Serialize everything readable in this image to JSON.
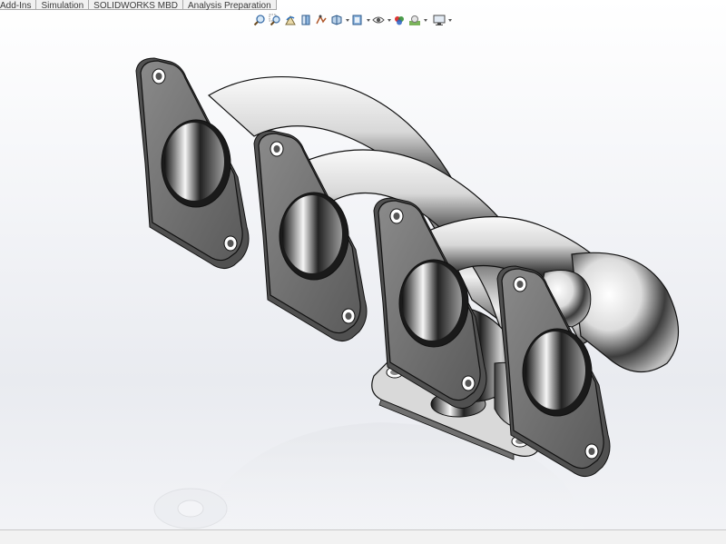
{
  "command_manager": {
    "tabs": [
      {
        "label": "Add-Ins"
      },
      {
        "label": "Simulation"
      },
      {
        "label": "SOLIDWORKS MBD"
      },
      {
        "label": "Analysis Preparation"
      }
    ]
  },
  "heads_up_toolbar": {
    "tools": [
      {
        "icon": "zoom-to-fit-icon"
      },
      {
        "icon": "zoom-to-area-icon"
      },
      {
        "icon": "previous-view-icon"
      },
      {
        "icon": "section-view-icon"
      },
      {
        "icon": "dynamic-annotation-view-icon"
      },
      {
        "icon": "view-orientation-icon"
      },
      {
        "icon": "display-style-icon"
      },
      {
        "icon": "hide-show-items-icon"
      },
      {
        "icon": "edit-appearance-icon"
      },
      {
        "icon": "apply-scene-icon"
      },
      {
        "icon": "view-settings-icon"
      }
    ]
  },
  "colors": {
    "background_top": "#ffffff",
    "background_bottom": "#e9ebf0",
    "metal_light": "#f2f2f2",
    "metal_dark": "#1e1e1e",
    "flange_face": "#6f6f6f",
    "edge": "#111111"
  }
}
